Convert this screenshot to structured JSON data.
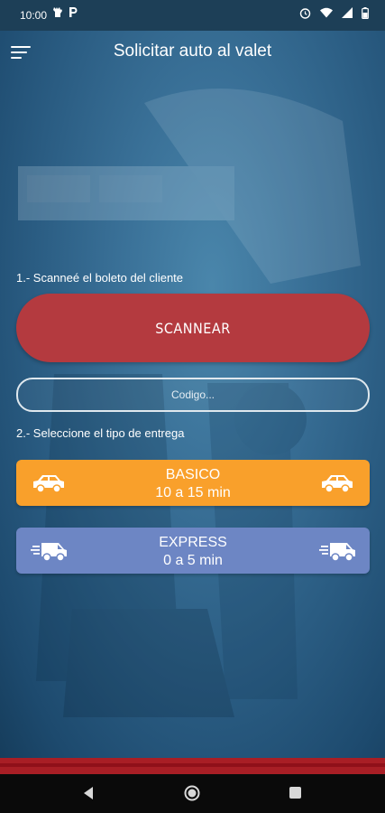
{
  "status_bar": {
    "time": "10:00",
    "left_icons": [
      "settings-icon",
      "parking-icon"
    ],
    "right_icons": [
      "alarm-icon",
      "wifi-icon",
      "signal-icon",
      "battery-icon"
    ]
  },
  "header": {
    "title": "Solicitar auto al valet",
    "menu_icon": "menu-icon"
  },
  "step1": {
    "label": "1.- Scanneé el boleto del cliente",
    "scan_button": "SCANNEAR",
    "code_placeholder": "Codigo..."
  },
  "step2": {
    "label": "2.- Seleccione el tipo de entrega",
    "options": [
      {
        "name": "BASICO",
        "time": "10 a 15 min",
        "icon": "car-icon",
        "color": "#f9a02b"
      },
      {
        "name": "EXPRESS",
        "time": "0 a 5 min",
        "icon": "van-icon",
        "color": "#6d86c4"
      }
    ]
  },
  "colors": {
    "scan_button": "#b43a3f",
    "bottom_strip": "#a81e25",
    "background": "#2a5c82"
  },
  "nav_bar": [
    "back-icon",
    "home-icon",
    "recents-icon"
  ]
}
